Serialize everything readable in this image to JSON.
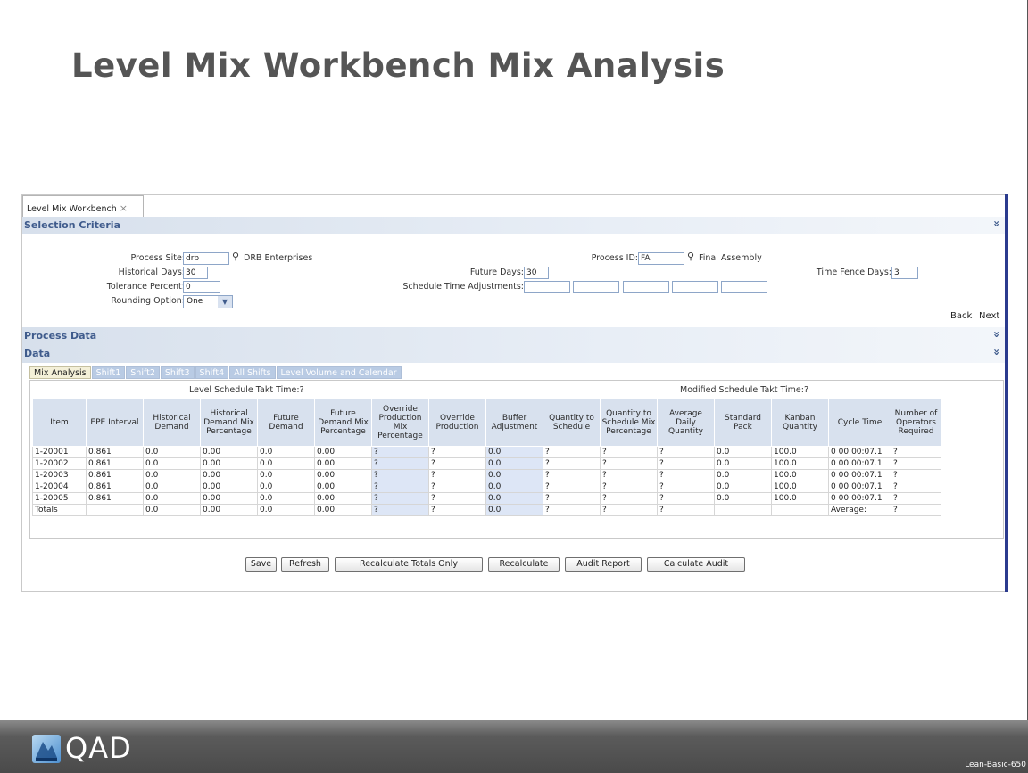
{
  "slide": {
    "title": "Level Mix Workbench Mix Analysis",
    "footer_brand": "QAD",
    "footer_code": "Lean-Basic-650"
  },
  "app": {
    "tab_label": "Level Mix Workbench",
    "tab_close": "×",
    "sections": {
      "selection_criteria": "Selection Criteria",
      "process_data": "Process Data",
      "data": "Data"
    },
    "collapse_glyph": "»"
  },
  "criteria": {
    "process_site_label": "Process Site:",
    "process_site_value": "drb",
    "process_site_desc": "DRB Enterprises",
    "historical_days_label": "Historical Days:",
    "historical_days_value": "30",
    "tolerance_percent_label": "Tolerance Percent:",
    "tolerance_percent_value": "0",
    "rounding_option_label": "Rounding Option:",
    "rounding_option_value": "One",
    "process_id_label": "Process ID:",
    "process_id_value": "FA",
    "process_id_desc": "Final Assembly",
    "future_days_label": "Future Days:",
    "future_days_value": "30",
    "schedule_time_adjustments_label": "Schedule Time Adjustments:",
    "time_fence_days_label": "Time Fence Days:",
    "time_fence_days_value": "3",
    "back_label": "Back",
    "next_label": "Next"
  },
  "data_tabs": [
    "Mix Analysis",
    "Shift1",
    "Shift2",
    "Shift3",
    "Shift4",
    "All Shifts",
    "Level Volume and Calendar"
  ],
  "grid": {
    "level_takt_label": "Level Schedule Takt Time:?",
    "modified_takt_label": "Modified Schedule Takt Time:?",
    "columns": [
      "Item",
      "EPE Interval",
      "Historical Demand",
      "Historical Demand Mix Percentage",
      "Future Demand",
      "Future Demand Mix Percentage",
      "Override Production Mix Percentage",
      "Override Production",
      "Buffer Adjustment",
      "Quantity to Schedule",
      "Quantity to Schedule Mix Percentage",
      "Average Daily Quantity",
      "Standard Pack",
      "Kanban Quantity",
      "Cycle Time",
      "Number of Operators Required"
    ],
    "rows": [
      [
        "1-20001",
        "0.861",
        "0.0",
        "0.00",
        "0.0",
        "0.00",
        "?",
        "?",
        "0.0",
        "?",
        "?",
        "?",
        "0.0",
        "100.0",
        "0 00:00:07.1",
        "?"
      ],
      [
        "1-20002",
        "0.861",
        "0.0",
        "0.00",
        "0.0",
        "0.00",
        "?",
        "?",
        "0.0",
        "?",
        "?",
        "?",
        "0.0",
        "100.0",
        "0 00:00:07.1",
        "?"
      ],
      [
        "1-20003",
        "0.861",
        "0.0",
        "0.00",
        "0.0",
        "0.00",
        "?",
        "?",
        "0.0",
        "?",
        "?",
        "?",
        "0.0",
        "100.0",
        "0 00:00:07.1",
        "?"
      ],
      [
        "1-20004",
        "0.861",
        "0.0",
        "0.00",
        "0.0",
        "0.00",
        "?",
        "?",
        "0.0",
        "?",
        "?",
        "?",
        "0.0",
        "100.0",
        "0 00:00:07.1",
        "?"
      ],
      [
        "1-20005",
        "0.861",
        "0.0",
        "0.00",
        "0.0",
        "0.00",
        "?",
        "?",
        "0.0",
        "?",
        "?",
        "?",
        "0.0",
        "100.0",
        "0 00:00:07.1",
        "?"
      ],
      [
        "Totals",
        "",
        "0.0",
        "0.00",
        "0.0",
        "0.00",
        "?",
        "?",
        "0.0",
        "?",
        "?",
        "?",
        "",
        "",
        "Average:",
        "?"
      ]
    ]
  },
  "buttons": {
    "save": "Save",
    "refresh": "Refresh",
    "recalculate_totals_only": "Recalculate Totals Only",
    "recalculate": "Recalculate",
    "audit_report": "Audit Report",
    "calculate_audit": "Calculate Audit"
  },
  "colors": {
    "accent_blue": "#2b3b8e",
    "section_text": "#3f5b8c",
    "editable_cell": "#dde6f6"
  }
}
